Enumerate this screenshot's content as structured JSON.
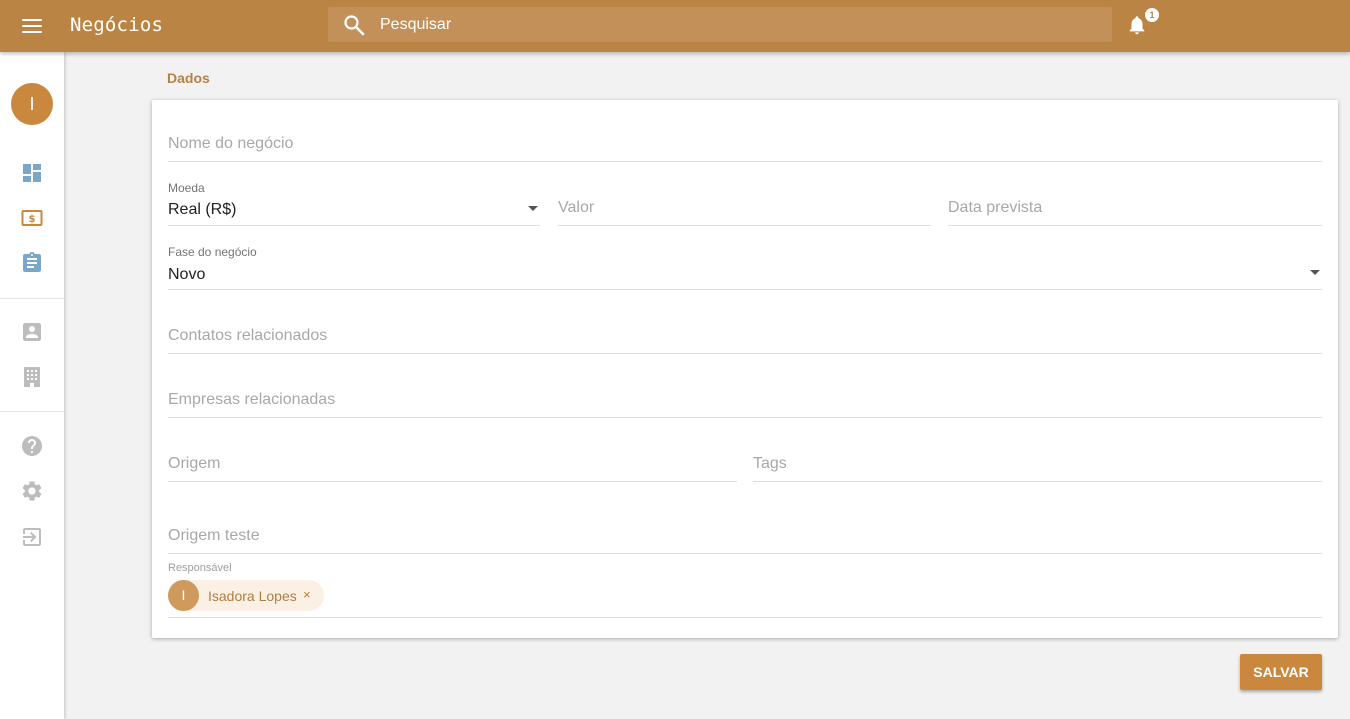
{
  "header": {
    "title": "Negócios",
    "search_placeholder": "Pesquisar",
    "notification_count": "1"
  },
  "sidebar": {
    "avatar_initial": "I",
    "items": [
      {
        "icon": "dashboard-icon",
        "color": "#7aa6c8"
      },
      {
        "icon": "deals-money-icon",
        "color": "#c9883e"
      },
      {
        "icon": "tasks-clipboard-icon",
        "color": "#7aa6c8"
      },
      {
        "icon": "contacts-icon",
        "color": "#bdbdbd"
      },
      {
        "icon": "companies-building-icon",
        "color": "#bdbdbd"
      },
      {
        "icon": "help-icon",
        "color": "#bdbdbd"
      },
      {
        "icon": "settings-gear-icon",
        "color": "#bdbdbd"
      },
      {
        "icon": "logout-icon",
        "color": "#bdbdbd"
      }
    ]
  },
  "form": {
    "section_title": "Dados",
    "nome_placeholder": "Nome do negócio",
    "moeda_label": "Moeda",
    "moeda_value": "Real (R$)",
    "valor_placeholder": "Valor",
    "data_placeholder": "Data prevista",
    "fase_label": "Fase do negócio",
    "fase_value": "Novo",
    "contatos_placeholder": "Contatos relacionados",
    "empresas_placeholder": "Empresas relacionadas",
    "origem_placeholder": "Origem",
    "tags_placeholder": "Tags",
    "origem_teste_placeholder": "Origem teste",
    "responsavel_label": "Responsável",
    "responsavel_chip": {
      "initial": "I",
      "name": "Isadora Lopes",
      "remove": "×"
    }
  },
  "actions": {
    "save_label": "SALVAR"
  },
  "colors": {
    "primary": "#ba8444",
    "accent": "#c9883e"
  }
}
